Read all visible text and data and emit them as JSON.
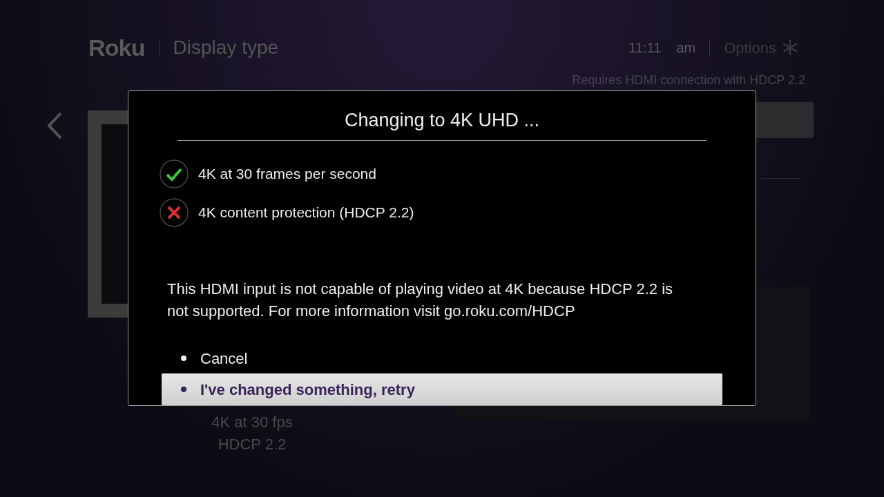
{
  "header": {
    "logo": "Roku",
    "title": "Display type",
    "time": "11:11",
    "meridiem": "am",
    "options": "Options"
  },
  "display": {
    "caption": [
      "4K at 30 fps",
      "HDCP 2.2"
    ]
  },
  "requirement": "Requires HDMI connection with HDCP 2.2",
  "dialog": {
    "title": "Changing to 4K UHD ...",
    "checks": [
      {
        "label": "4K at 30 frames per second",
        "passed": true
      },
      {
        "label": "4K content protection (HDCP 2.2)",
        "passed": false
      }
    ],
    "message": "This HDMI input is not capable of playing video at 4K because HDCP 2.2 is not supported. For more information visit go.roku.com/HDCP",
    "options": [
      {
        "label": "Cancel",
        "selected": false
      },
      {
        "label": "I've changed something, retry",
        "selected": true
      }
    ]
  }
}
